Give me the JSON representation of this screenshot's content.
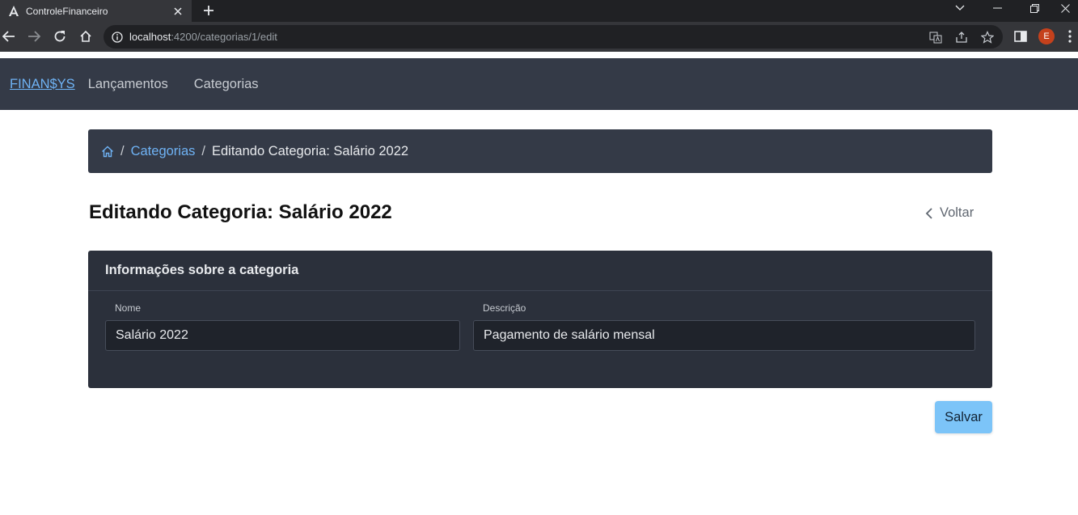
{
  "browser": {
    "tab_title": "ControleFinanceiro",
    "new_tab": "+",
    "url_host": "localhost",
    "url_rest": ":4200/categorias/1/edit",
    "avatar_letter": "E"
  },
  "navbar": {
    "brand": "FINAN$YS",
    "links": [
      "Lançamentos",
      "Categorias"
    ]
  },
  "breadcrumb": {
    "separator": "/",
    "link": "Categorias",
    "current": "Editando Categoria: Salário 2022"
  },
  "page": {
    "title": "Editando Categoria: Salário 2022",
    "back_label": "Voltar"
  },
  "card": {
    "header": "Informações sobre a categoria",
    "fields": {
      "nome": {
        "label": "Nome",
        "value": "Salário 2022"
      },
      "descricao": {
        "label": "Descrição",
        "value": "Pagamento de salário mensal"
      }
    }
  },
  "actions": {
    "save_label": "Salvar"
  },
  "colors": {
    "navbar_bg": "#343a47",
    "card_bg": "#2b303b",
    "link": "#6fb3f5",
    "save_button": "#7cc4f8"
  }
}
